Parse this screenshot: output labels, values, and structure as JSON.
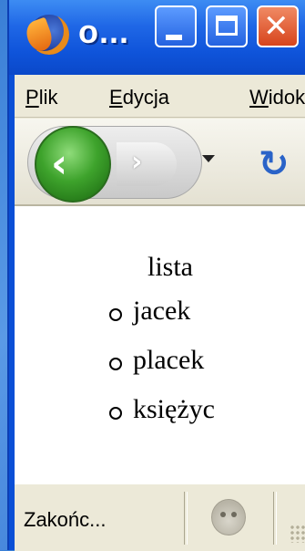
{
  "window": {
    "title": "o..."
  },
  "menubar": {
    "items": [
      {
        "underline": "P",
        "rest": "lik"
      },
      {
        "underline": "E",
        "rest": "dycja"
      },
      {
        "underline": "W",
        "rest": "idok"
      }
    ]
  },
  "content": {
    "heading": "lista",
    "items": [
      "jacek",
      "placek",
      "księżyc"
    ]
  },
  "status": {
    "text": "Zakońc..."
  },
  "colors": {
    "titlebar": "#0f54da",
    "close_button": "#d7441c",
    "back_button": "#3ea32c",
    "reload_icon": "#2a63c8",
    "chrome": "#ece9d8"
  },
  "icons": {
    "app": "firefox-icon",
    "back": "back-arrow-icon",
    "forward": "forward-arrow-icon",
    "dropdown": "dropdown-triangle-icon",
    "reload": "reload-icon",
    "status": "activity-indicator-icon"
  }
}
